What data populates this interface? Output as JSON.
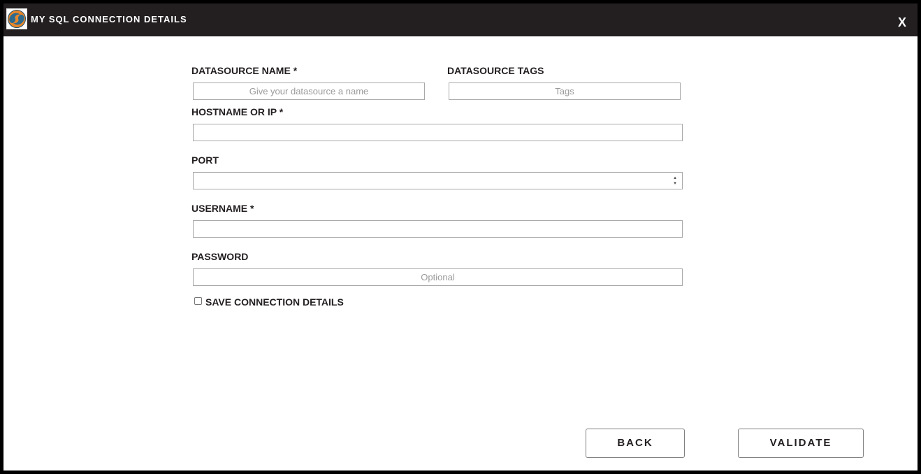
{
  "window": {
    "title": "MY SQL CONNECTION DETAILS",
    "close_label": "X",
    "logo_icon": "mysql-dolphin-logo-icon"
  },
  "form": {
    "datasource_name": {
      "label": "DATASOURCE NAME *",
      "value": "",
      "placeholder": "Give your datasource a name"
    },
    "datasource_tags": {
      "label": "DATASOURCE TAGS",
      "value": "",
      "placeholder": "Tags"
    },
    "hostname": {
      "label": "HOSTNAME OR IP *",
      "value": "",
      "placeholder": ""
    },
    "port": {
      "label": "PORT",
      "value": "",
      "placeholder": ""
    },
    "username": {
      "label": "USERNAME *",
      "value": "",
      "placeholder": ""
    },
    "password": {
      "label": "PASSWORD",
      "value": "",
      "placeholder": "Optional"
    },
    "save_connection": {
      "label": "SAVE CONNECTION DETAILS",
      "checked": false
    }
  },
  "actions": {
    "back_label": "BACK",
    "validate_label": "VALIDATE"
  },
  "colors": {
    "titlebar_bg": "#231f20",
    "logo_orange": "#e8872a",
    "logo_blue": "#2d6a8e"
  }
}
